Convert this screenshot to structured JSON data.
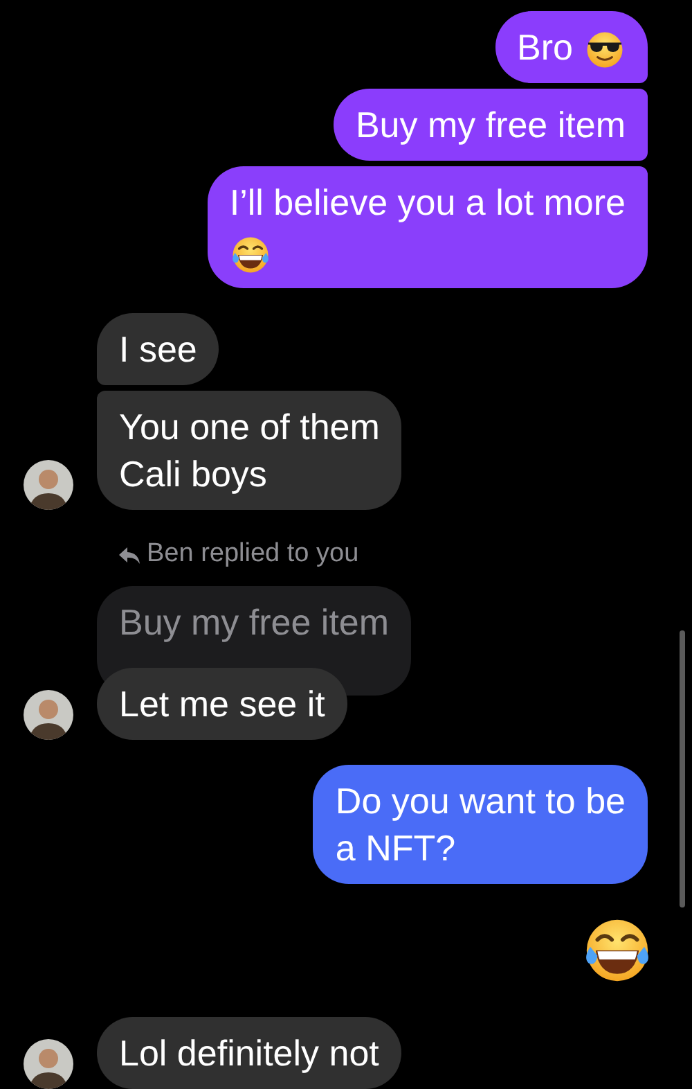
{
  "groups": [
    {
      "kind": "outgoing",
      "messages": [
        {
          "kind": "cool",
          "lines": [
            "Bro"
          ],
          "color": "#8b3dfc"
        },
        {
          "kind": "plain",
          "lines": [
            "Buy my free item"
          ],
          "color": "#8b3dfc"
        },
        {
          "kind": "laughing",
          "lines": [
            "I’ll believe you a lot more"
          ],
          "color": "#8a3ffb"
        }
      ]
    },
    {
      "kind": "incoming",
      "messages": [
        {
          "kind": "plain",
          "lines": [
            "I see"
          ]
        },
        {
          "kind": "plain",
          "lines": [
            "You one of them",
            "Cali boys"
          ]
        }
      ]
    },
    {
      "kind": "incoming",
      "reply_label": "Ben replied to you",
      "quoted": "Buy my free item",
      "messages": [
        {
          "kind": "plain",
          "lines": [
            "Let me see it"
          ]
        }
      ]
    },
    {
      "kind": "outgoing",
      "messages": [
        {
          "kind": "plain",
          "lines": [
            "Do you want to be",
            "a NFT?"
          ],
          "color": "#4a6cf7"
        }
      ]
    },
    {
      "kind": "outgoing",
      "messages": [
        {
          "kind": "emoji"
        }
      ]
    },
    {
      "kind": "incoming",
      "messages": [
        {
          "kind": "plain",
          "lines": [
            "Lol definitely not"
          ]
        }
      ]
    }
  ]
}
